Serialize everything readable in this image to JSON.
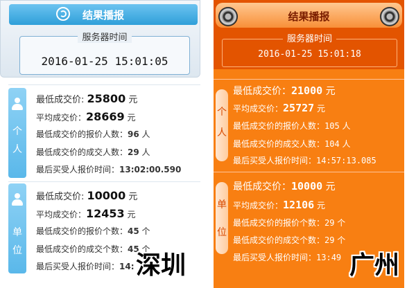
{
  "left": {
    "header": {
      "title": "结果播报",
      "server_time_label": "服务器时间",
      "server_time": "2016-01-25 15:01:05"
    },
    "individual": {
      "side_label_1": "个",
      "side_label_2": "人",
      "min_price_label": "最低成交价:",
      "min_price": "25800",
      "min_price_unit": "元",
      "avg_price_label": "平均成交价：",
      "avg_price": "28669",
      "avg_price_unit": "元",
      "bidders_label": "最低成交价的报价人数：",
      "bidders": "96",
      "bidders_unit": "人",
      "deals_label": "最低成交价的成交人数：",
      "deals": "29",
      "deals_unit": "人",
      "last_time_label": "最后买受人报价时间：",
      "last_time": "13:02:00.590"
    },
    "unit": {
      "side_label_1": "单",
      "side_label_2": "位",
      "min_price_label": "最低成交价:",
      "min_price": "10000",
      "min_price_unit": "元",
      "avg_price_label": "平均成交价：",
      "avg_price": "12453",
      "avg_price_unit": "元",
      "bidders_label": "最低成交价的报价个数：",
      "bidders": "45",
      "bidders_unit": "个",
      "deals_label": "最低成交价的成交个数：",
      "deals": "45",
      "deals_unit": "个",
      "last_time_label": "最后买受人报价时间：",
      "last_time": "14:"
    },
    "city": "深圳"
  },
  "right": {
    "header": {
      "title": "结果播报",
      "server_time_label": "服务器时间",
      "server_time": "2016-01-25 15:01:18"
    },
    "individual": {
      "side_label_1": "个",
      "side_label_2": "人",
      "min_price_label": "最低成交价：",
      "min_price": "21000",
      "min_price_unit": "元",
      "avg_price_label": "平均成交价：",
      "avg_price": "25727",
      "avg_price_unit": "元",
      "bidders_label": "最低成交价的报价人数：",
      "bidders": "105",
      "bidders_unit": "人",
      "deals_label": "最低成交价的成交人数：",
      "deals": "104",
      "deals_unit": "人",
      "last_time_label": "最后买受人报价时间：",
      "last_time": "14:57:13.085"
    },
    "unit": {
      "side_label_1": "单",
      "side_label_2": "位",
      "min_price_label": "最低成交价：",
      "min_price": "10000",
      "min_price_unit": "元",
      "avg_price_label": "平均成交价：",
      "avg_price": "12106",
      "avg_price_unit": "元",
      "bidders_label": "最低成交价的报价个数：",
      "bidders": "29",
      "bidders_unit": "个",
      "deals_label": "最低成交价的成交个数：",
      "deals": "29",
      "deals_unit": "个",
      "last_time_label": "最后买受人报价时间：",
      "last_time": "13:49"
    },
    "city": "广州"
  },
  "colors": {
    "left_accent": "#2f9fd9",
    "right_accent": "#e35400",
    "right_bg": "#f87f12"
  },
  "icons": {
    "left_header": "refresh-icon",
    "left_side": "person-icon",
    "right_header": "wheel-icon"
  }
}
